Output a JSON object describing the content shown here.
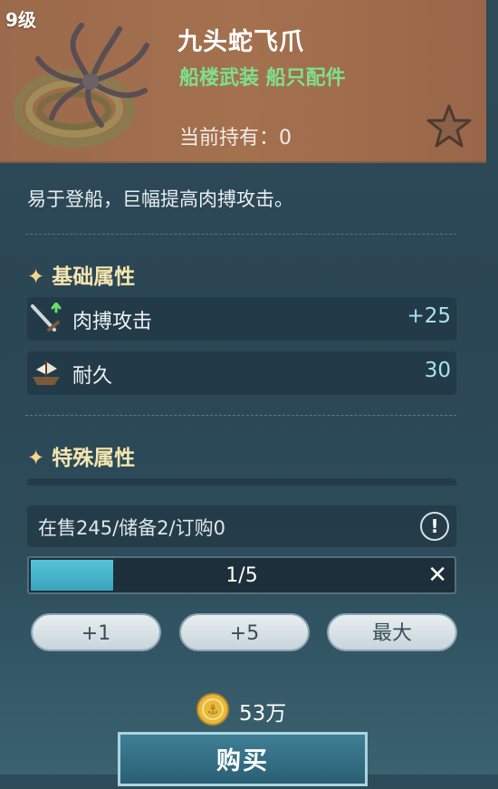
{
  "item": {
    "level": "9级",
    "name": "九头蛇飞爪",
    "category": "船楼武装 船只配件",
    "owned_label": "当前持有：",
    "owned_value": "0",
    "icon": "grappling-hook-icon",
    "favorite_icon": "star-icon"
  },
  "description": "易于登船，巨幅提高肉搏攻击。",
  "base_section": {
    "title": "基础属性",
    "stats": [
      {
        "name": "肉搏攻击",
        "value": "+25",
        "icon": "sword-icon"
      },
      {
        "name": "耐久",
        "value": "30",
        "icon": "ship-icon"
      }
    ]
  },
  "special_section": {
    "title": "特殊属性"
  },
  "market": {
    "info": "在售245/储备2/订购0",
    "info_icon": "exclamation-icon"
  },
  "quantity": {
    "text": "1/5",
    "progress": 0.2,
    "close_icon": "close-icon"
  },
  "buttons": {
    "plus1": "+1",
    "plus5": "+5",
    "max": "最大"
  },
  "price": {
    "value": "53万",
    "icon": "gold-coin-icon"
  },
  "buy_label": "购买",
  "colors": {
    "header_bg": "#a4714f",
    "category_green": "#7ee08a",
    "stat_value": "#a6e3f0",
    "section_title": "#f5e6b0"
  }
}
